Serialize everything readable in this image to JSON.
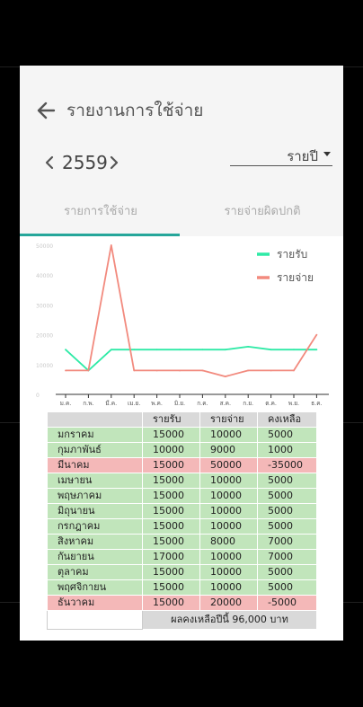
{
  "header": {
    "title": "รายงานการใช้จ่าย",
    "year": "2559",
    "period_value": "รายปี"
  },
  "tabs": [
    {
      "label": "รายการใช้จ่าย"
    },
    {
      "label": "รายจ่ายผิดปกติ"
    }
  ],
  "colors": {
    "income": "#2eeaa6",
    "expense": "#f28a7e",
    "tab_indicator": "#26a69a",
    "normal_row": "#c1e5bb",
    "deficit_row": "#f4b8b8"
  },
  "chart_data": {
    "type": "line",
    "categories": [
      "ม.ค.",
      "ก.พ.",
      "มี.ค.",
      "เม.ย.",
      "พ.ค.",
      "มิ.ย.",
      "ก.ค.",
      "ส.ค.",
      "ก.ย.",
      "ต.ค.",
      "พ.ย.",
      "ธ.ค."
    ],
    "y_ticks": [
      "0",
      "10000",
      "20000",
      "30000",
      "40000",
      "50000"
    ],
    "ylim": [
      0,
      50000
    ],
    "legend_position": "top-right",
    "series": [
      {
        "name": "รายรับ",
        "color": "#2eeaa6",
        "values": [
          15000,
          8000,
          15000,
          15000,
          15000,
          15000,
          15000,
          15000,
          16000,
          15000,
          15000,
          15000
        ]
      },
      {
        "name": "รายจ่าย",
        "color": "#f28a7e",
        "values": [
          8000,
          8000,
          50000,
          8000,
          8000,
          8000,
          8000,
          6000,
          8000,
          8000,
          8000,
          20000
        ]
      }
    ]
  },
  "table": {
    "headers": [
      "",
      "รายรับ",
      "รายจ่าย",
      "คงเหลือ"
    ],
    "rows": [
      {
        "month": "มกราคม",
        "income": "15000",
        "expense": "10000",
        "balance": "5000",
        "status": "normal"
      },
      {
        "month": "กุมภาพันธ์",
        "income": "10000",
        "expense": "9000",
        "balance": "1000",
        "status": "normal"
      },
      {
        "month": "มีนาคม",
        "income": "15000",
        "expense": "50000",
        "balance": "-35000",
        "status": "deficit"
      },
      {
        "month": "เมษายน",
        "income": "15000",
        "expense": "10000",
        "balance": "5000",
        "status": "normal"
      },
      {
        "month": "พฤษภาคม",
        "income": "15000",
        "expense": "10000",
        "balance": "5000",
        "status": "normal"
      },
      {
        "month": "มิถุนายน",
        "income": "15000",
        "expense": "10000",
        "balance": "5000",
        "status": "normal"
      },
      {
        "month": "กรกฎาคม",
        "income": "15000",
        "expense": "10000",
        "balance": "5000",
        "status": "normal"
      },
      {
        "month": "สิงหาคม",
        "income": "15000",
        "expense": "8000",
        "balance": "7000",
        "status": "normal"
      },
      {
        "month": "กันยายน",
        "income": "17000",
        "expense": "10000",
        "balance": "7000",
        "status": "normal"
      },
      {
        "month": "ตุลาคม",
        "income": "15000",
        "expense": "10000",
        "balance": "5000",
        "status": "normal"
      },
      {
        "month": "พฤศจิกายน",
        "income": "15000",
        "expense": "10000",
        "balance": "5000",
        "status": "normal"
      },
      {
        "month": "ธันวาคม",
        "income": "15000",
        "expense": "20000",
        "balance": "-5000",
        "status": "deficit"
      }
    ],
    "footer": "ผลคงเหลือปีนี้ 96,000 บาท"
  }
}
